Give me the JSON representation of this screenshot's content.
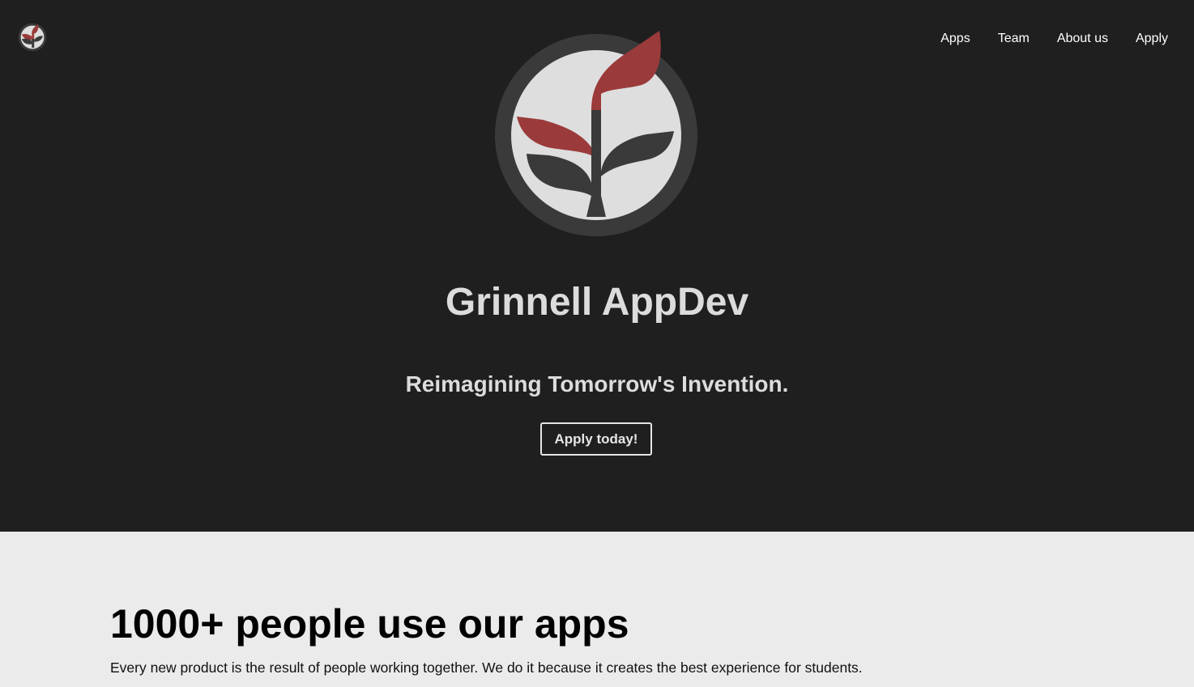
{
  "nav": {
    "logo_icon": "grinnell-appdev-logo-icon",
    "items": [
      {
        "label": "Apps"
      },
      {
        "label": "Team"
      },
      {
        "label": "About us"
      },
      {
        "label": "Apply"
      }
    ]
  },
  "hero": {
    "logo_icon": "grinnell-appdev-logo-icon",
    "title": "Grinnell AppDev",
    "tagline": "Reimagining Tomorrow's Invention.",
    "cta_label": "Apply today!"
  },
  "stats": {
    "title": "1000+ people use our apps",
    "text": "Every new product is the result of people working together. We do it because it creates the best experience for students."
  },
  "colors": {
    "hero_background": "#1f1f1f",
    "section_background": "#ebebeb",
    "logo_red": "#9b3a3a",
    "logo_dark": "#3a3a3a",
    "logo_light": "#dedede"
  }
}
